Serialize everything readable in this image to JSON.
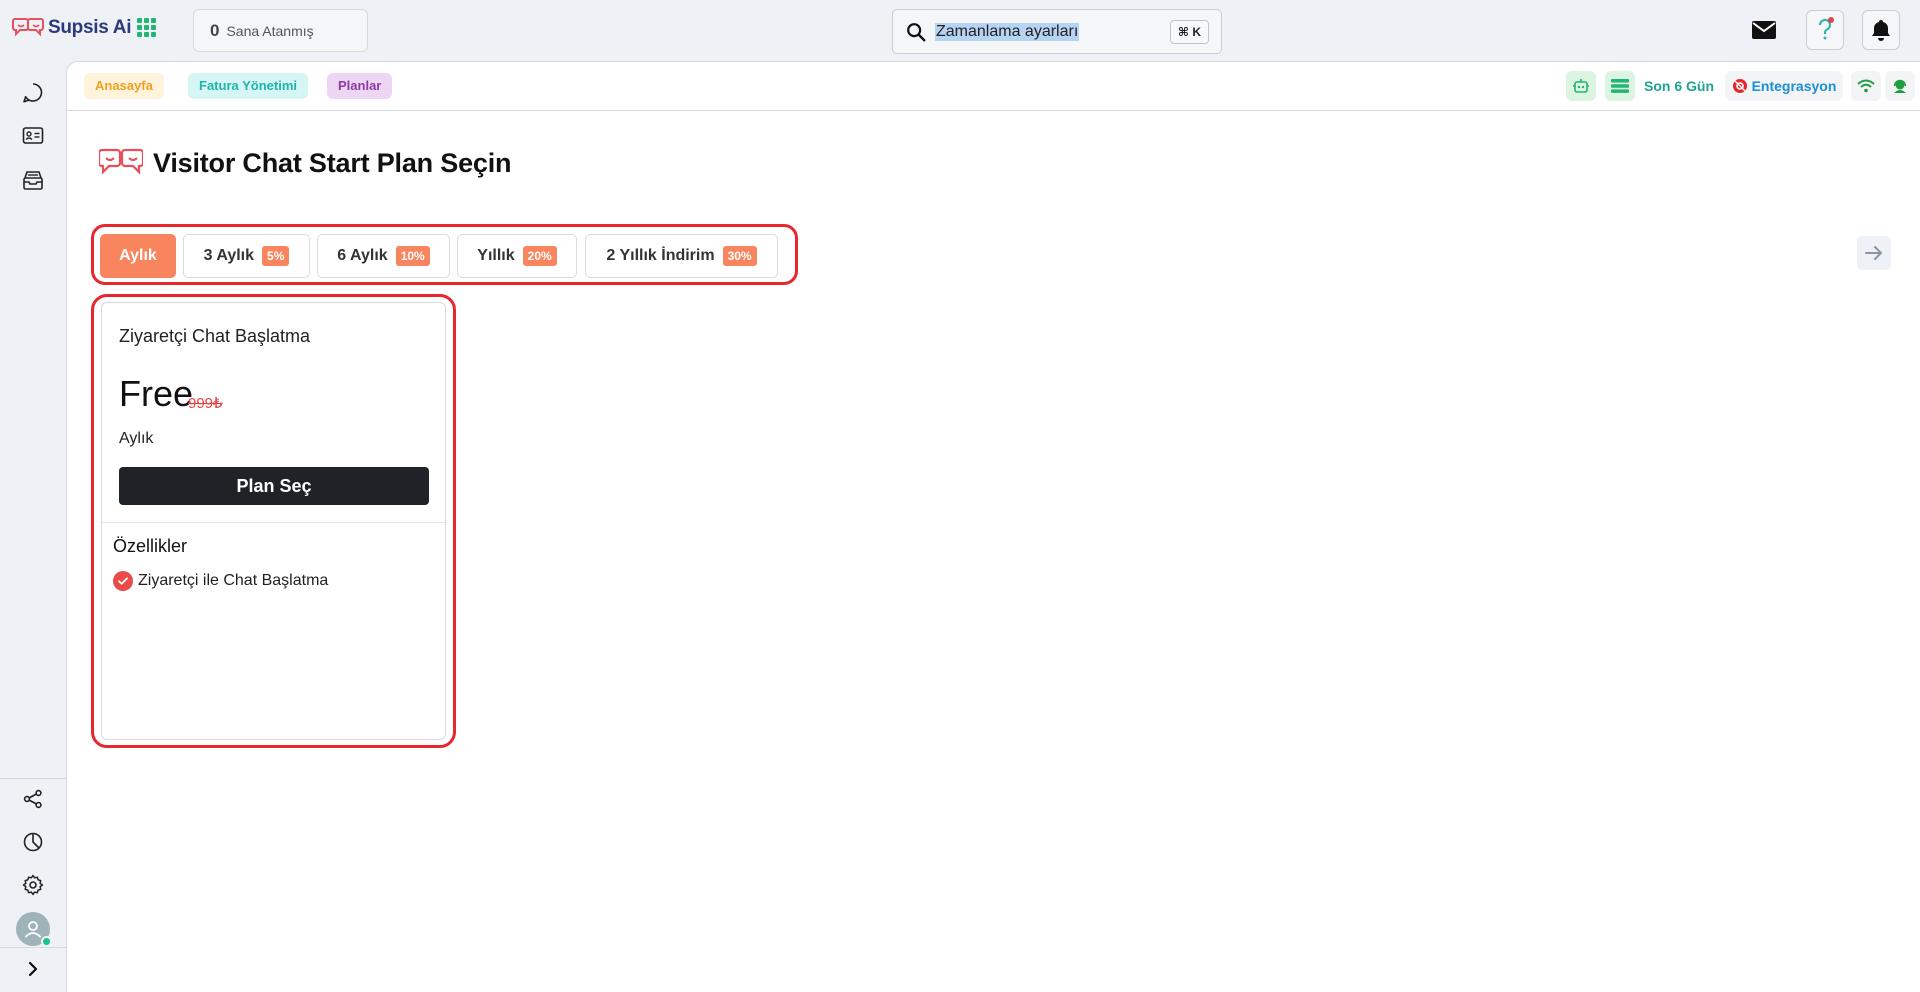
{
  "app": {
    "logo_text": "Supsis Ai",
    "assigned_count": "0",
    "assigned_label": "Sana Atanmış"
  },
  "search": {
    "value": "Zamanlama ayarları",
    "shortcut": "⌘ K"
  },
  "breadcrumb": {
    "home": "Anasayfa",
    "invoice": "Fatura Yönetimi",
    "plans": "Planlar"
  },
  "status": {
    "range": "Son 6 Gün",
    "integration": "Entegrasyon"
  },
  "page": {
    "title": "Visitor Chat Start Plan Seçin"
  },
  "periods": [
    {
      "label": "Aylık",
      "badge": ""
    },
    {
      "label": "3 Aylık",
      "badge": "5%"
    },
    {
      "label": "6 Aylık",
      "badge": "10%"
    },
    {
      "label": "Yıllık",
      "badge": "20%"
    },
    {
      "label": "2 Yıllık İndirim",
      "badge": "30%"
    }
  ],
  "plan": {
    "name": "Ziyaretçi Chat Başlatma",
    "price": "Free",
    "old_price": "999₺",
    "period": "Aylık",
    "button": "Plan Seç",
    "features_title": "Özellikler",
    "features": [
      "Ziyaretçi ile Chat Başlatma"
    ]
  },
  "colors": {
    "accent": "#f8855e",
    "highlight_border": "#e8262e",
    "brand": "#2c3a7c"
  },
  "icons": {
    "logo": "chat-bubbles-logo-icon",
    "apps": "apps-grid-icon",
    "search": "search-icon",
    "mail": "mail-icon",
    "help": "question-icon",
    "bell": "bell-icon"
  }
}
